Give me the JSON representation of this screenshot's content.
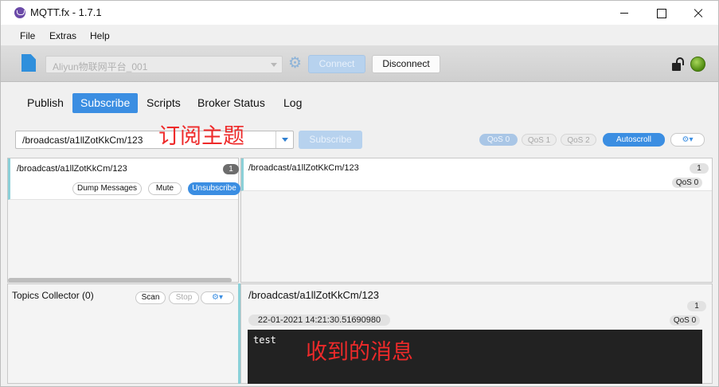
{
  "window": {
    "title": "MQTT.fx - 1.7.1"
  },
  "menu": {
    "items": [
      "File",
      "Extras",
      "Help"
    ]
  },
  "connection": {
    "profile": "Aliyun物联网平台_001",
    "connect_label": "Connect",
    "disconnect_label": "Disconnect",
    "status_color": "#6aaa1f"
  },
  "tabs": [
    {
      "label": "Publish",
      "active": false
    },
    {
      "label": "Subscribe",
      "active": true
    },
    {
      "label": "Scripts",
      "active": false
    },
    {
      "label": "Broker Status",
      "active": false
    },
    {
      "label": "Log",
      "active": false
    }
  ],
  "subscribe_bar": {
    "topic_value": "/broadcast/a1llZotKkCm/123",
    "subscribe_label": "Subscribe",
    "qos": [
      "QoS 0",
      "QoS 1",
      "QoS 2"
    ],
    "selected_qos": "QoS 0",
    "autoscroll_label": "Autoscroll",
    "options_icon": "gears-dropdown-icon"
  },
  "annotations": {
    "subscribe_topic": "订阅主题",
    "received_message": "收到的消息"
  },
  "subscriptions": [
    {
      "topic": "/broadcast/a1llZotKkCm/123",
      "count": "1",
      "dump_label": "Dump Messages",
      "mute_label": "Mute",
      "unsubscribe_label": "Unsubscribe"
    }
  ],
  "messages": [
    {
      "topic": "/broadcast/a1llZotKkCm/123",
      "number": "1",
      "qos": "QoS 0"
    }
  ],
  "collector": {
    "title": "Topics Collector (0)",
    "scan_label": "Scan",
    "stop_label": "Stop"
  },
  "detail": {
    "topic": "/broadcast/a1llZotKkCm/123",
    "number": "1",
    "timestamp": "22-01-2021  14:21:30.51690980",
    "qos": "QoS 0",
    "payload": "test"
  },
  "colors": {
    "accent": "#3b8ee2",
    "annotation": "#ee2a2a",
    "payload_bg": "#222222"
  }
}
